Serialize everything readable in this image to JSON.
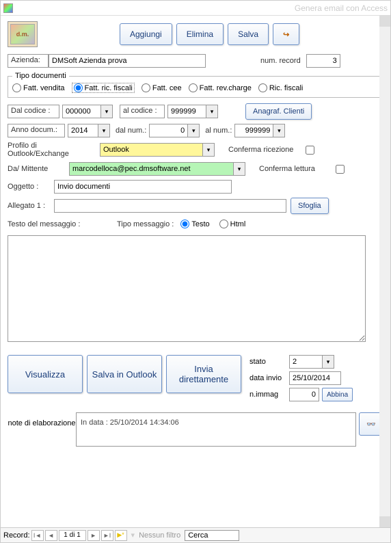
{
  "window": {
    "title": "Genera email con Access"
  },
  "toolbar": {
    "aggiungi": "Aggiungi",
    "elimina": "Elimina",
    "salva": "Salva",
    "exit_glyph": "↪"
  },
  "header": {
    "azienda_label": "Azienda:",
    "azienda_value": "DMSoft Azienda prova",
    "num_record_label": "num. record",
    "num_record_value": "3"
  },
  "tipo_doc": {
    "legend": "Tipo documenti",
    "options": {
      "fatt_vendita": "Fatt. vendita",
      "fatt_ric_fiscali": "Fatt. ric. fiscali",
      "fatt_cee": "Fatt. cee",
      "fatt_rev_charge": "Fatt. rev.charge",
      "ric_fiscali": "Ric. fiscali"
    },
    "selected": "fatt_ric_fiscali"
  },
  "range": {
    "dal_codice_label": "Dal codice :",
    "dal_codice_value": "000000",
    "al_codice_label": "al codice :",
    "al_codice_value": "999999",
    "anagraf_btn": "Anagraf. Clienti",
    "anno_label": "Anno docum.:",
    "anno_value": "2014",
    "dal_num_label": "dal num.:",
    "dal_num_value": "0",
    "al_num_label": "al num.:",
    "al_num_value": "999999"
  },
  "mail": {
    "profilo_label": "Profilo di Outlook/Exchange",
    "profilo_value": "Outlook",
    "conferma_ric_label": "Conferma ricezione",
    "mittente_label": "Da/ Mittente",
    "mittente_value": "marcodelloca@pec.dmsoftware.net",
    "conferma_let_label": "Conferma lettura",
    "oggetto_label": "Oggetto :",
    "oggetto_value": "Invio documenti",
    "allegato_label": "Allegato 1 :",
    "allegato_value": "",
    "sfoglia_btn": "Sfoglia"
  },
  "msg": {
    "testo_label": "Testo del messaggio :",
    "tipo_label": "Tipo messaggio :",
    "tipo_testo": "Testo",
    "tipo_html": "Html",
    "body": ""
  },
  "actions": {
    "visualizza": "Visualizza",
    "salva_outlook": "Salva in Outlook",
    "invia": "Invia direttamente"
  },
  "status": {
    "stato_label": "stato",
    "stato_value": "2",
    "data_label": "data invio",
    "data_value": "25/10/2014",
    "nimmag_label": "n.immag",
    "nimmag_value": "0",
    "abbina_btn": "Abbina"
  },
  "note": {
    "label": "note di elaborazione",
    "text": "In data : 25/10/2014 14:34:06",
    "eye": "👓"
  },
  "nav": {
    "record_label": "Record:",
    "pos": "1 di 1",
    "filter": "Nessun filtro",
    "search": "Cerca"
  }
}
